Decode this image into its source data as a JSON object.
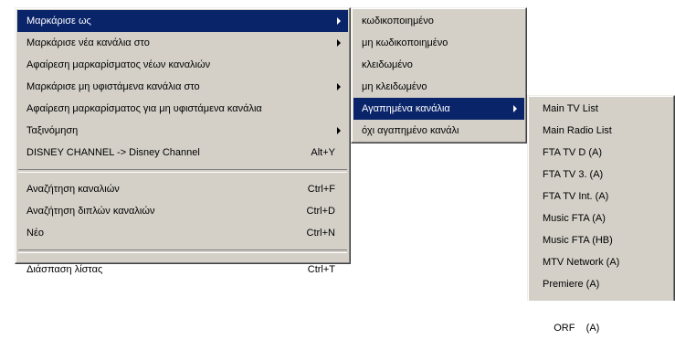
{
  "main_menu": {
    "items": [
      {
        "label": "Μαρκάρισε ως",
        "shortcut": "",
        "submenu": true,
        "highlighted": true
      },
      {
        "label": "Μαρκάρισε νέα κανάλια στο",
        "shortcut": "",
        "submenu": true
      },
      {
        "label": "Αφαίρεση μαρκαρίσματος νέων καναλιών",
        "shortcut": "",
        "submenu": false
      },
      {
        "label": "Μαρκάρισε μη υφιστάμενα κανάλια στο",
        "shortcut": "",
        "submenu": true
      },
      {
        "label": "Αφαίρεση μαρκαρίσματος για μη υφιστάμενα κανάλια",
        "shortcut": "",
        "submenu": false
      },
      {
        "label": "Ταξινόμηση",
        "shortcut": "",
        "submenu": true
      },
      {
        "label": "DISNEY CHANNEL -> Disney Channel",
        "shortcut": "Alt+Y",
        "submenu": false
      },
      {
        "label": "Αναζήτηση καναλιών",
        "shortcut": "Ctrl+F",
        "submenu": false
      },
      {
        "label": "Αναζήτηση διπλών καναλιών",
        "shortcut": "Ctrl+D",
        "submenu": false
      },
      {
        "label": "Νέο",
        "shortcut": "Ctrl+N",
        "submenu": false
      },
      {
        "label": "Διάσπαση λίστας",
        "shortcut": "Ctrl+T",
        "submenu": false
      }
    ]
  },
  "submenu_mark_as": {
    "items": [
      {
        "label": "κωδικοποιημένο"
      },
      {
        "label": "μη κωδικοποιημένο"
      },
      {
        "label": "κλειδωμένο"
      },
      {
        "label": "μη κλειδωμένο"
      },
      {
        "label": "Αγαπημένα κανάλια",
        "highlighted": true,
        "submenu": true
      },
      {
        "label": "όχι αγαπημένο κανάλι"
      }
    ]
  },
  "submenu_favorites": {
    "items": [
      {
        "label": "Main TV List"
      },
      {
        "label": "Main Radio List"
      },
      {
        "label": "FTA TV D (A)"
      },
      {
        "label": "FTA TV 3. (A)"
      },
      {
        "label": "FTA TV Int. (A)"
      },
      {
        "label": "Music FTA (A)"
      },
      {
        "label": "Music FTA (HB)"
      },
      {
        "label": "MTV Network (A)"
      },
      {
        "label": "Premiere (A)"
      },
      {
        "label": "ORF    (A)"
      }
    ]
  },
  "colors": {
    "menu_background": "#d4d0c8",
    "highlight": "#0a246a",
    "highlight_text": "#ffffff"
  }
}
